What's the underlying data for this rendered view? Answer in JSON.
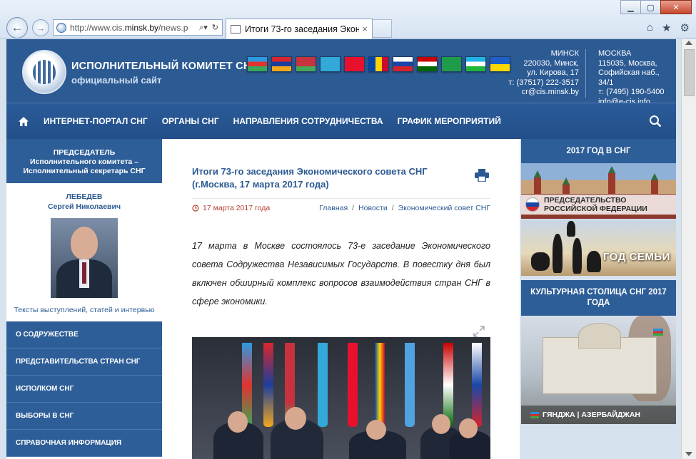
{
  "browser": {
    "url_prefix": "http://www.cis.",
    "url_domain": "minsk.by",
    "url_suffix": "/news.p",
    "tab_title": "Итоги 73-го заседания Эконо…",
    "tab_close": "×",
    "win_min": "▁",
    "win_max": "▢",
    "win_close": "✕"
  },
  "header": {
    "brand_line1": "ИСПОЛНИТЕЛЬНЫЙ КОМИТЕТ СНГ",
    "brand_line2": "официальный сайт",
    "minsk": {
      "city": "МИНСК",
      "line1": "220030, Минск,",
      "line2": "ул. Кирова, 17",
      "phone": "т: (37517) 222-3517",
      "email": "cr@cis.minsk.by"
    },
    "moscow": {
      "city": "МОСКВА",
      "line1": "115035, Москва,",
      "line2": "Софийская наб., 34/1",
      "phone": "т: (7495) 190-5400",
      "email": "info@e-cis.info"
    },
    "flags": [
      {
        "name": "azerbaijan",
        "colors": [
          "#2d9ae0",
          "#e0342f",
          "#3aa657"
        ]
      },
      {
        "name": "armenia",
        "colors": [
          "#d9262c",
          "#1d3e9c",
          "#f2a81d"
        ]
      },
      {
        "name": "belarus",
        "colors": [
          "#c8313e",
          "#c8313e",
          "#4aa657"
        ]
      },
      {
        "name": "kazakhstan",
        "colors": [
          "#32a9d8",
          "#32a9d8",
          "#32a9d8"
        ]
      },
      {
        "name": "kyrgyzstan",
        "colors": [
          "#e8112d",
          "#e8112d",
          "#e8112d"
        ]
      },
      {
        "name": "moldova",
        "colors": [
          "#0046ae",
          "#ffd200",
          "#cc092f"
        ]
      },
      {
        "name": "russia",
        "colors": [
          "#ffffff",
          "#1b46a8",
          "#d4242b"
        ]
      },
      {
        "name": "tajikistan",
        "colors": [
          "#cc0000",
          "#ffffff",
          "#006600"
        ]
      },
      {
        "name": "turkmenistan",
        "colors": [
          "#1f9c4a",
          "#1f9c4a",
          "#1f9c4a"
        ]
      },
      {
        "name": "uzbekistan",
        "colors": [
          "#1eb5e6",
          "#ffffff",
          "#1eb53a"
        ]
      },
      {
        "name": "ukraine",
        "colors": [
          "#1f5fc6",
          "#1f5fc6",
          "#ffd700"
        ]
      }
    ]
  },
  "nav": {
    "items": [
      "ИНТЕРНЕТ-ПОРТАЛ СНГ",
      "ОРГАНЫ СНГ",
      "НАПРАВЛЕНИЯ СОТРУДНИЧЕСТВА",
      "ГРАФИК МЕРОПРИЯТИЙ"
    ]
  },
  "left": {
    "chair_title1": "ПРЕДСЕДАТЕЛЬ",
    "chair_title2": "Исполнительного комитета –",
    "chair_title3": "Исполнительный секретарь СНГ",
    "name1": "ЛЕБЕДЕВ",
    "name2": "Сергей Николаевич",
    "speeches_link": "Тексты выступлений, статей и интервью",
    "menu": [
      "О СОДРУЖЕСТВЕ",
      "ПРЕДСТАВИТЕЛЬСТВА СТРАН СНГ",
      "ИСПОЛКОМ СНГ",
      "ВЫБОРЫ В СНГ",
      "СПРАВОЧНАЯ ИНФОРМАЦИЯ"
    ]
  },
  "article": {
    "title": "Итоги 73-го заседания Экономического совета СНГ (г.Москва, 17 марта 2017 года)",
    "date": "17 марта 2017 года",
    "crumbs": [
      "Главная",
      "Новости",
      "Экономический совет СНГ"
    ],
    "crumb_sep": "/",
    "lead": "17 марта в Москве состоялось 73-е заседание Экономического совета Содружества Независимых Государств. В повестку дня был включен обширный комплекс вопросов взаимодействия стран СНГ в сфере экономики."
  },
  "right": {
    "year_head": "2017 ГОД В СНГ",
    "banner1_text": "ПРЕДСЕДАТЕЛЬСТВО РОССИЙСКОЙ ФЕДЕРАЦИИ",
    "banner2_text": "ГОД СЕМЬИ",
    "culture_head": "КУЛЬТУРНАЯ СТОЛИЦА СНГ 2017 ГОДА",
    "banner3_text": "ГЯНДЖА | АЗЕРБАЙДЖАН"
  }
}
